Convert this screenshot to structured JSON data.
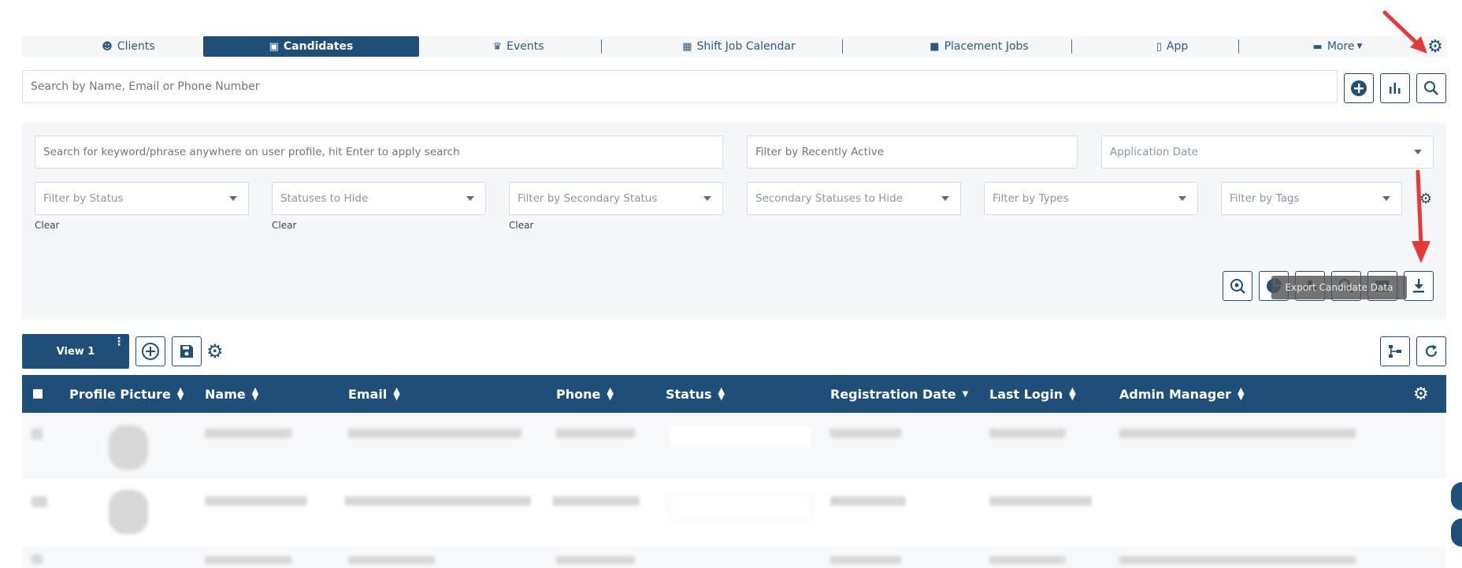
{
  "nav": {
    "items": [
      {
        "label": "Clients",
        "icon": "face-icon"
      },
      {
        "label": "Candidates",
        "icon": "id-card-icon",
        "active": true
      },
      {
        "label": "Events",
        "icon": "trophy-icon"
      },
      {
        "label": "Shift Job Calendar",
        "icon": "calendar-icon"
      },
      {
        "label": "Placement Jobs",
        "icon": "briefcase-icon"
      },
      {
        "label": "App",
        "icon": "phone-icon"
      },
      {
        "label": "More",
        "icon": "message-icon"
      }
    ]
  },
  "search": {
    "placeholder": "Search by Name, Email or Phone Number"
  },
  "filters": {
    "keyword_placeholder": "Search for keyword/phrase anywhere on user profile, hit Enter to apply search",
    "recently_active_placeholder": "Filter by Recently Active",
    "application_date_placeholder": "Application Date",
    "status_placeholder": "Filter by Status",
    "statuses_hide_placeholder": "Statuses to Hide",
    "secondary_status_placeholder": "Filter by Secondary Status",
    "secondary_hide_placeholder": "Secondary Statuses to Hide",
    "types_placeholder": "Filter by Types",
    "tags_placeholder": "Filter by Tags",
    "clear_label": "Clear",
    "tooltip": "Export Candidate Data"
  },
  "views": {
    "tab_label": "View 1"
  },
  "table": {
    "columns": [
      "Profile Picture",
      "Name",
      "Email",
      "Phone",
      "Status",
      "Registration Date",
      "Last Login",
      "Admin Manager"
    ]
  },
  "colors": {
    "primary": "#1f4e79",
    "panel": "#f5f7fa",
    "annotation": "#e53935"
  }
}
